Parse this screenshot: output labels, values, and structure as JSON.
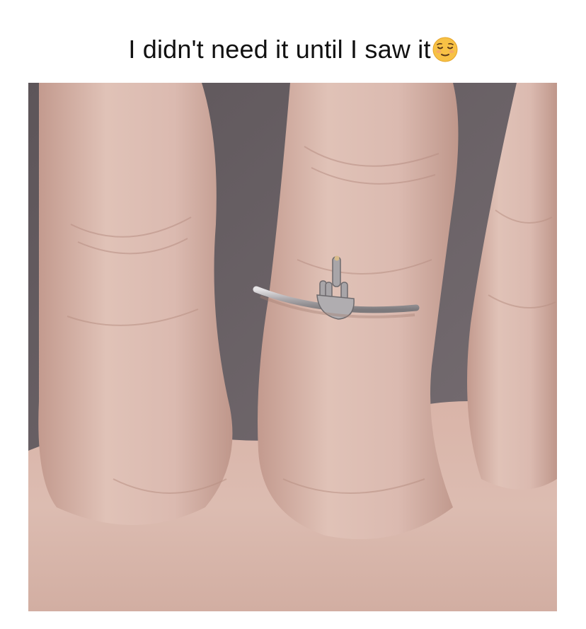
{
  "caption": {
    "text": "I didn't need it until I saw it",
    "emoji_icon": "relieved-face-emoji"
  },
  "photo": {
    "subject_icon": "middle-finger-ring-icon",
    "colors": {
      "skin": "#dcb9ad",
      "skin_shadow": "#c99e92",
      "background": "#6a6266",
      "silver": "#b9b7b9"
    }
  }
}
